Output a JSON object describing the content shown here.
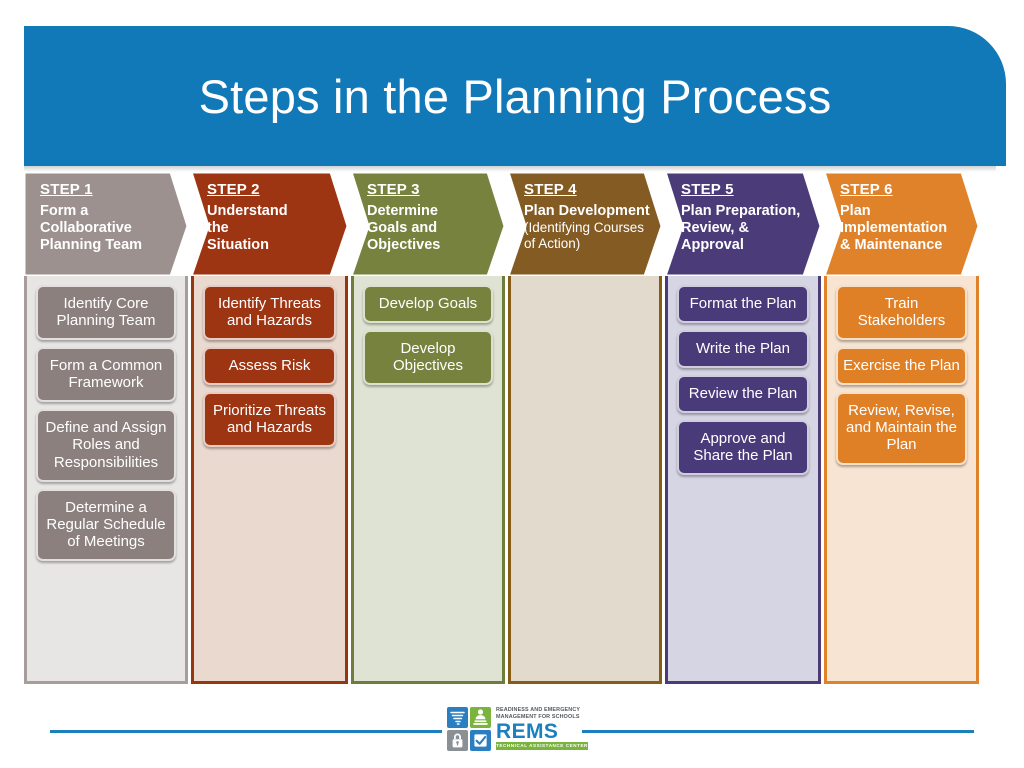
{
  "slide": {
    "title": "Steps in the Planning Process",
    "title_bar_color": "#1179b8"
  },
  "diagram": {
    "columns": [
      {
        "step_label": "STEP 1",
        "title": "Form a Collaborative Planning Team",
        "title_lines": [
          "Form a",
          "Collaborative",
          "Planning Team"
        ],
        "subtitle_lines": [],
        "header_color": "#9c918e",
        "task_color": "#8b807d",
        "panel_bg": "#e8e6e5",
        "panel_border": "#a79e9c",
        "tasks": [
          "Identify Core Planning Team",
          "Form a Common Framework",
          "Define and Assign Roles and Responsibilities",
          "Determine a Regular Schedule of Meetings"
        ]
      },
      {
        "step_label": "STEP 2",
        "title": "Understand the Situation",
        "title_lines": [
          "Understand",
          "the",
          "Situation"
        ],
        "subtitle_lines": [],
        "header_color": "#9d3412",
        "task_color": "#9d3412",
        "panel_bg": "#ead9cf",
        "panel_border": "#95380f",
        "tasks": [
          "Identify Threats and Hazards",
          "Assess Risk",
          "Prioritize Threats and Hazards"
        ]
      },
      {
        "step_label": "STEP 3",
        "title": "Determine Goals and Objectives",
        "title_lines": [
          "Determine",
          "Goals and",
          "Objectives"
        ],
        "subtitle_lines": [],
        "header_color": "#76823e",
        "task_color": "#76823e",
        "panel_bg": "#dfe3d3",
        "panel_border": "#6e7c3c",
        "tasks": [
          "Develop Goals",
          "Develop Objectives"
        ]
      },
      {
        "step_label": "STEP 4",
        "title": "Plan Development",
        "title_lines": [
          "Plan Development"
        ],
        "subtitle_lines": [
          "(Identifying Courses",
          "of Action)"
        ],
        "header_color": "#835b23",
        "task_color": "#835b23",
        "panel_bg": "#e2dacd",
        "panel_border": "#865d16",
        "tasks": []
      },
      {
        "step_label": "STEP 5",
        "title": "Plan Preparation, Review, & Approval",
        "title_lines": [
          "Plan Preparation,",
          "Review, &",
          "Approval"
        ],
        "subtitle_lines": [],
        "header_color": "#4b3c79",
        "task_color": "#493a79",
        "panel_bg": "#d6d5e4",
        "panel_border": "#4b3c79",
        "tasks": [
          "Format the Plan",
          "Write the Plan",
          "Review the Plan",
          "Approve and Share the Plan"
        ]
      },
      {
        "step_label": "STEP 6",
        "title": "Plan Implementation & Maintenance",
        "title_lines": [
          "Plan",
          "Implementation",
          "& Maintenance"
        ],
        "subtitle_lines": [],
        "header_color": "#e0822a",
        "task_color": "#df8027",
        "panel_bg": "#f7e4d2",
        "panel_border": "#e0822a",
        "tasks": [
          "Train Stakeholders",
          "Exercise the Plan",
          "Review, Revise, and Maintain the Plan"
        ]
      }
    ]
  },
  "footer": {
    "logo": {
      "tagline": "READINESS AND EMERGENCY MANAGEMENT FOR SCHOOLS",
      "acronym": "REMS",
      "subtitle": "TECHNICAL ASSISTANCE CENTER",
      "icons": [
        "tornado-icon",
        "people-icon",
        "lock-icon",
        "checkbox-icon"
      ]
    },
    "rule_color": "#1c7fbe"
  }
}
